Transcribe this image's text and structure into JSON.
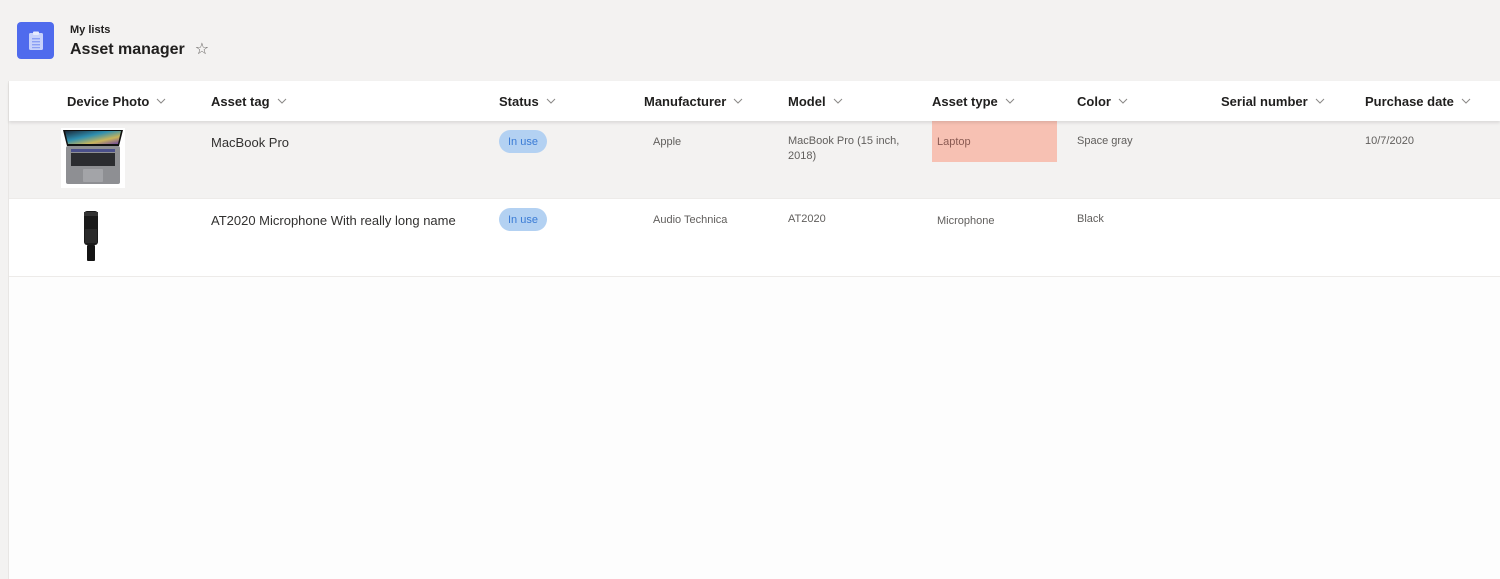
{
  "header": {
    "breadcrumb": "My lists",
    "title": "Asset manager",
    "app_icon": "clipboard-list-icon",
    "favorite_icon": "star-outline-icon",
    "app_icon_color": "#4f6bed"
  },
  "columns": [
    {
      "key": "photo",
      "label": "Device Photo"
    },
    {
      "key": "asset_tag",
      "label": "Asset tag"
    },
    {
      "key": "status",
      "label": "Status"
    },
    {
      "key": "manufacturer",
      "label": "Manufacturer"
    },
    {
      "key": "model",
      "label": "Model"
    },
    {
      "key": "asset_type",
      "label": "Asset type"
    },
    {
      "key": "color",
      "label": "Color"
    },
    {
      "key": "serial_number",
      "label": "Serial number"
    },
    {
      "key": "purchase_date",
      "label": "Purchase date"
    }
  ],
  "rows": [
    {
      "photo": "laptop-image",
      "asset_tag": "MacBook Pro",
      "status": "In use",
      "manufacturer": "Apple",
      "model": "MacBook Pro (15 inch, 2018)",
      "asset_type": "Laptop",
      "color": "Space gray",
      "serial_number": "",
      "purchase_date": "10/7/2020",
      "selected": true
    },
    {
      "photo": "microphone-image",
      "asset_tag": "AT2020 Microphone With really long name",
      "status": "In use",
      "manufacturer": "Audio Technica",
      "model": "AT2020",
      "asset_type": "Microphone",
      "color": "Black",
      "serial_number": "",
      "purchase_date": ""
    }
  ],
  "colors": {
    "status_pill_bg": "#b3d1f2",
    "status_pill_text": "#3a7bd5",
    "laptop_type_bg": "#f7c1b3",
    "selected_row_bg": "#f3f2f1"
  }
}
